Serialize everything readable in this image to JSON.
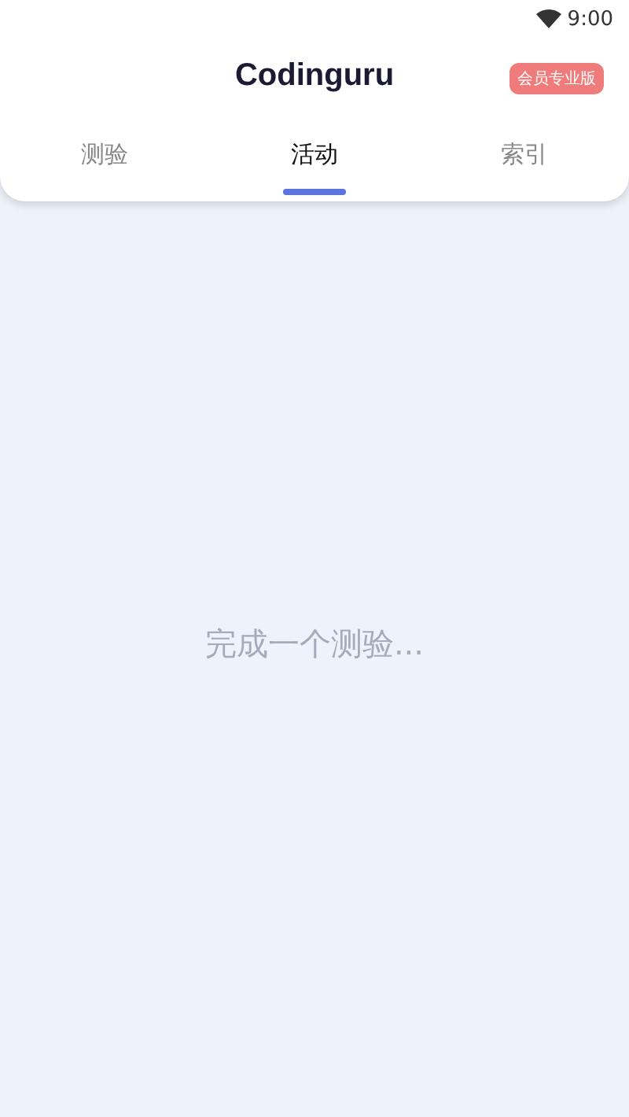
{
  "status_bar": {
    "time": "9:00"
  },
  "header": {
    "title": "Codinguru",
    "badge": "会员专业版"
  },
  "tabs": [
    {
      "label": "测验",
      "selected": false
    },
    {
      "label": "活动",
      "selected": true
    },
    {
      "label": "索引",
      "selected": false
    }
  ],
  "empty_message": "完成一个测验..."
}
